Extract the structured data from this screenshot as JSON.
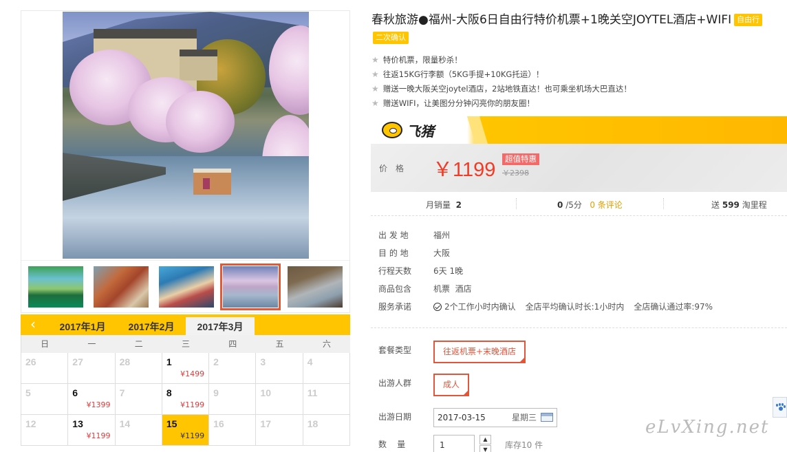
{
  "product": {
    "title": "春秋旅游●福州-大阪6日自由行特价机票+1晚关空JOYTEL酒店+WIFI",
    "tag_self": "自由行",
    "tag_confirm": "二次确认",
    "features": [
      "特价机票，限量秒杀！",
      "往返15KG行李额（5KG手提+10KG托运）！",
      "赠送一晚大阪关空joytel酒店，2站地铁直达！也可乘坐机场大巴直达！",
      "赠送WIFI，让美图分分钟闪亮你的朋友圈！"
    ]
  },
  "brand": {
    "name": "飞猪"
  },
  "price": {
    "label": "价格",
    "current": "￥1199",
    "badge": "超值特惠",
    "original": "￥2398"
  },
  "stats": {
    "monthly_sales_label": "月销量",
    "monthly_sales": "2",
    "score": "0",
    "score_suffix": "/5分",
    "reviews": "0 条评论",
    "points_prefix": "送",
    "points": "599",
    "points_suffix": "淘里程"
  },
  "info": {
    "rows": [
      {
        "label": "出 发 地",
        "value": "福州"
      },
      {
        "label": "目 的 地",
        "value": "大阪"
      },
      {
        "label": "行程天数",
        "value": "6天 1晚"
      },
      {
        "label": "商品包含",
        "value": "机票  酒店"
      }
    ],
    "promise_label": "服务承诺",
    "promises": [
      "2个工作小时内确认",
      "全店平均确认时长:1小时内",
      "全店确认通过率:97%"
    ]
  },
  "options": {
    "package_label": "套餐类型",
    "package_value": "往返机票+末晚酒店",
    "crowd_label": "出游人群",
    "crowd_value": "成人",
    "date_label": "出游日期",
    "date_value": "2017-03-15",
    "weekday": "星期三",
    "qty_label": "数    量",
    "qty_value": "1",
    "stock": "库存10 件"
  },
  "calendar": {
    "prev_icon": "chevron-left-icon",
    "tabs": [
      "2017年1月",
      "2017年2月",
      "2017年3月"
    ],
    "active_tab": 2,
    "weekdays": [
      "日",
      "一",
      "二",
      "三",
      "四",
      "五",
      "六"
    ],
    "cells": [
      {
        "d": "26",
        "p": "",
        "on": false
      },
      {
        "d": "27",
        "p": "",
        "on": false
      },
      {
        "d": "28",
        "p": "",
        "on": false
      },
      {
        "d": "1",
        "p": "¥1499",
        "on": true
      },
      {
        "d": "2",
        "p": "",
        "on": false
      },
      {
        "d": "3",
        "p": "",
        "on": false
      },
      {
        "d": "4",
        "p": "",
        "on": false
      },
      {
        "d": "5",
        "p": "",
        "on": false
      },
      {
        "d": "6",
        "p": "¥1399",
        "on": true
      },
      {
        "d": "7",
        "p": "",
        "on": false
      },
      {
        "d": "8",
        "p": "¥1199",
        "on": true
      },
      {
        "d": "9",
        "p": "",
        "on": false
      },
      {
        "d": "10",
        "p": "",
        "on": false
      },
      {
        "d": "11",
        "p": "",
        "on": false
      },
      {
        "d": "12",
        "p": "",
        "on": false
      },
      {
        "d": "13",
        "p": "¥1199",
        "on": true
      },
      {
        "d": "14",
        "p": "",
        "on": false
      },
      {
        "d": "15",
        "p": "¥1199",
        "on": true,
        "picked": true
      },
      {
        "d": "16",
        "p": "",
        "on": false
      },
      {
        "d": "17",
        "p": "",
        "on": false
      },
      {
        "d": "18",
        "p": "",
        "on": false
      }
    ]
  },
  "watermark": "eLvXing.net",
  "colors": {
    "accent": "#ffc500",
    "price": "#f03c26",
    "selected_border": "#e2553b"
  }
}
